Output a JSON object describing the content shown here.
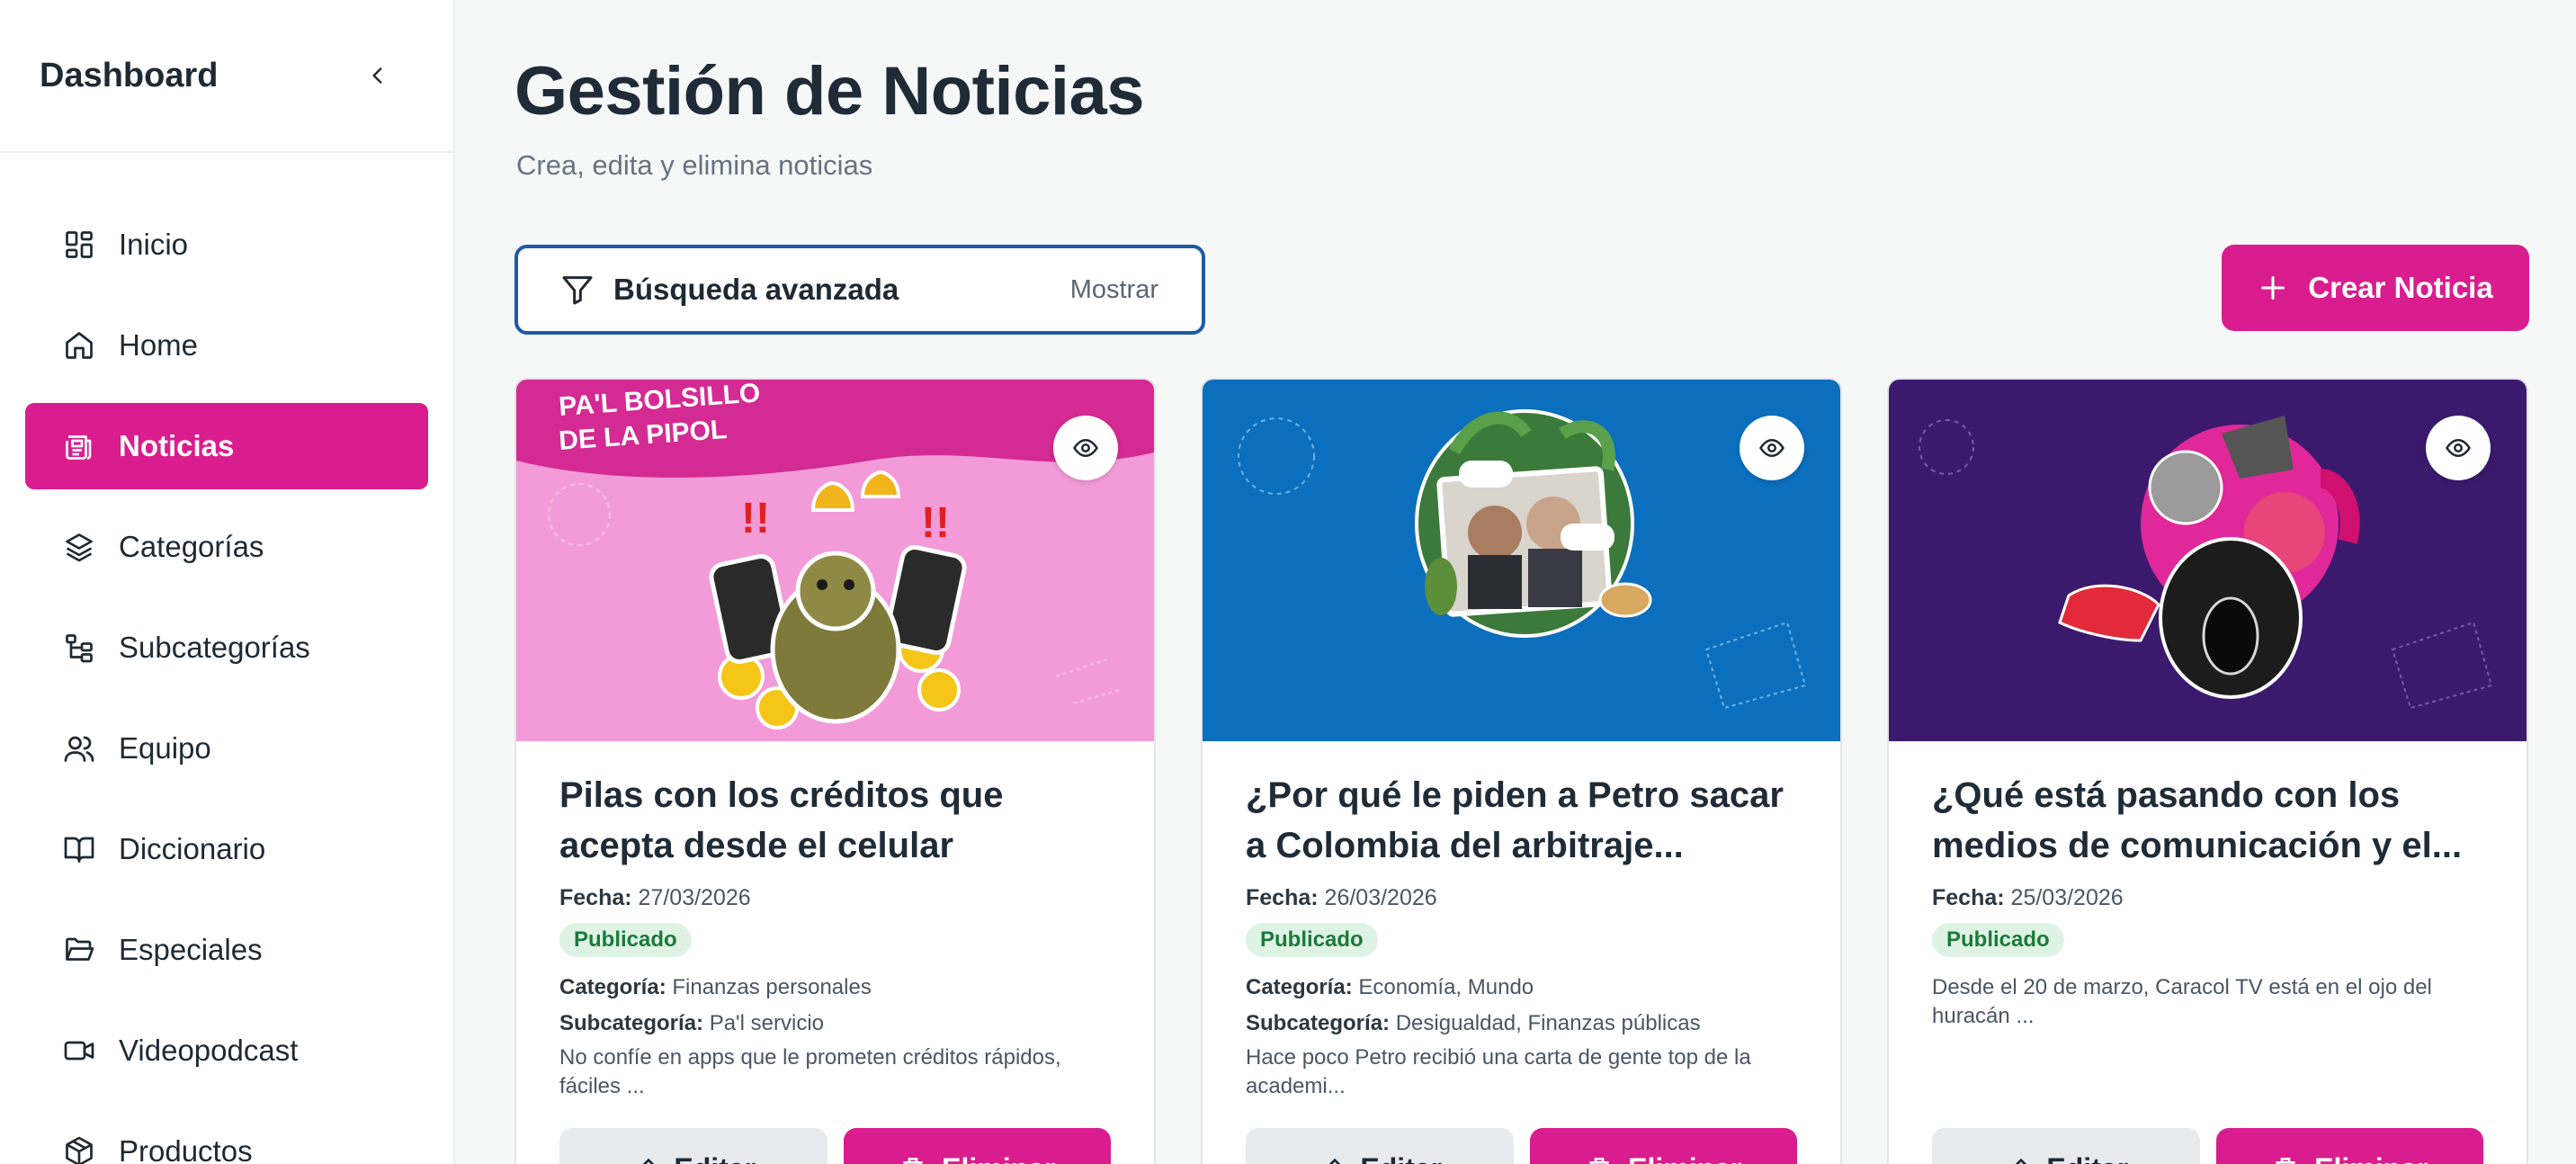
{
  "sidebar": {
    "title": "Dashboard",
    "items": [
      {
        "label": "Inicio",
        "icon": "grid-icon"
      },
      {
        "label": "Home",
        "icon": "home-icon"
      },
      {
        "label": "Noticias",
        "icon": "newspaper-icon",
        "active": true
      },
      {
        "label": "Categorías",
        "icon": "layers-icon"
      },
      {
        "label": "Subcategorías",
        "icon": "tree-icon"
      },
      {
        "label": "Equipo",
        "icon": "users-icon"
      },
      {
        "label": "Diccionario",
        "icon": "book-icon"
      },
      {
        "label": "Especiales",
        "icon": "folder-icon"
      },
      {
        "label": "Videopodcast",
        "icon": "video-icon"
      },
      {
        "label": "Productos",
        "icon": "package-icon"
      }
    ]
  },
  "header": {
    "title": "Gestión de Noticias",
    "subtitle": "Crea, edita y elimina noticias"
  },
  "search": {
    "label": "Búsqueda avanzada",
    "toggle": "Mostrar"
  },
  "create_label": "Crear Noticia",
  "labels": {
    "fecha": "Fecha:",
    "categoria": "Categoría:",
    "subcategoria": "Subcategoría:",
    "edit": "Editar",
    "delete": "Eliminar"
  },
  "cards": [
    {
      "title": "Pilas con los créditos que acepta desde el celular",
      "date": "27/03/2026",
      "status": "Publicado",
      "category": "Finanzas personales",
      "subcategory": "Pa'l servicio",
      "excerpt": "No confíe en apps que le prometen créditos rápidos, fáciles ...",
      "image_text": "PA'L BOLSILLO DE LA PIPOL",
      "bg": "#f29bd8"
    },
    {
      "title": "¿Por qué le piden a Petro sacar a Colombia del arbitraje...",
      "date": "26/03/2026",
      "status": "Publicado",
      "category": "Economía, Mundo",
      "subcategory": "Desigualdad, Finanzas públicas",
      "excerpt": "Hace poco Petro recibió una carta de gente top de la academi...",
      "bg": "#0b6fbd"
    },
    {
      "title": "¿Qué está pasando con los medios de comunicación y el...",
      "date": "25/03/2026",
      "status": "Publicado",
      "excerpt": "Desde el 20 de marzo, Caracol TV está en el ojo del huracán ...",
      "bg": "#3b1a6e"
    }
  ],
  "colors": {
    "accent": "#d91d8e",
    "focus": "#1e5aa6",
    "success_bg": "#dff3e4",
    "success_fg": "#1b7a3c"
  }
}
